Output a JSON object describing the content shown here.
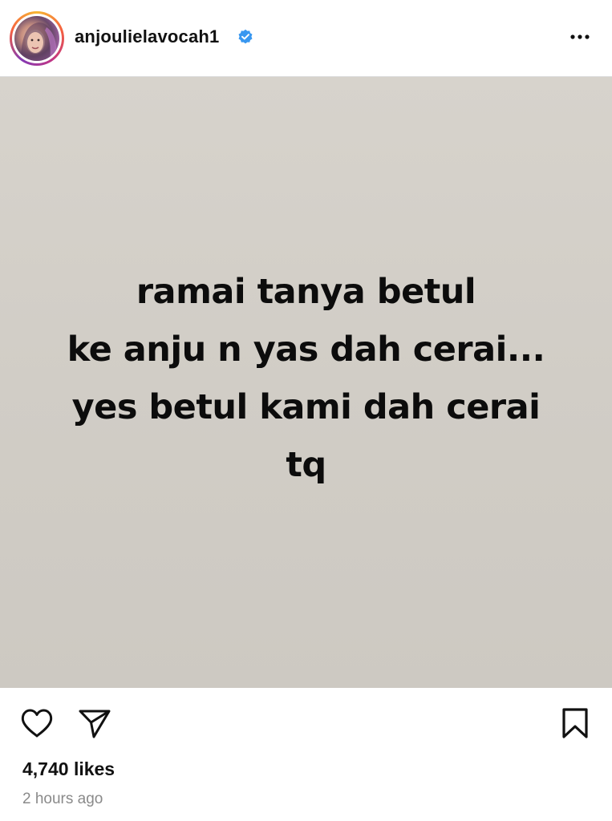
{
  "header": {
    "username": "anjoulielavocah1",
    "verified": true,
    "avatar_icon": "profile-photo",
    "more_icon": "more-horizontal-icon"
  },
  "post": {
    "background_color": "#d2cec7",
    "text_lines": [
      "ramai tanya betul",
      "ke anju n yas dah cerai...",
      "yes betul kami dah cerai",
      "tq"
    ]
  },
  "actions": {
    "like_icon": "heart-icon",
    "share_icon": "paper-plane-icon",
    "save_icon": "bookmark-icon"
  },
  "footer": {
    "likes": "4,740 likes",
    "timestamp": "2 hours ago"
  },
  "colors": {
    "verified_blue": "#3897f0",
    "text": "#111111",
    "muted": "#8a8a8a"
  }
}
